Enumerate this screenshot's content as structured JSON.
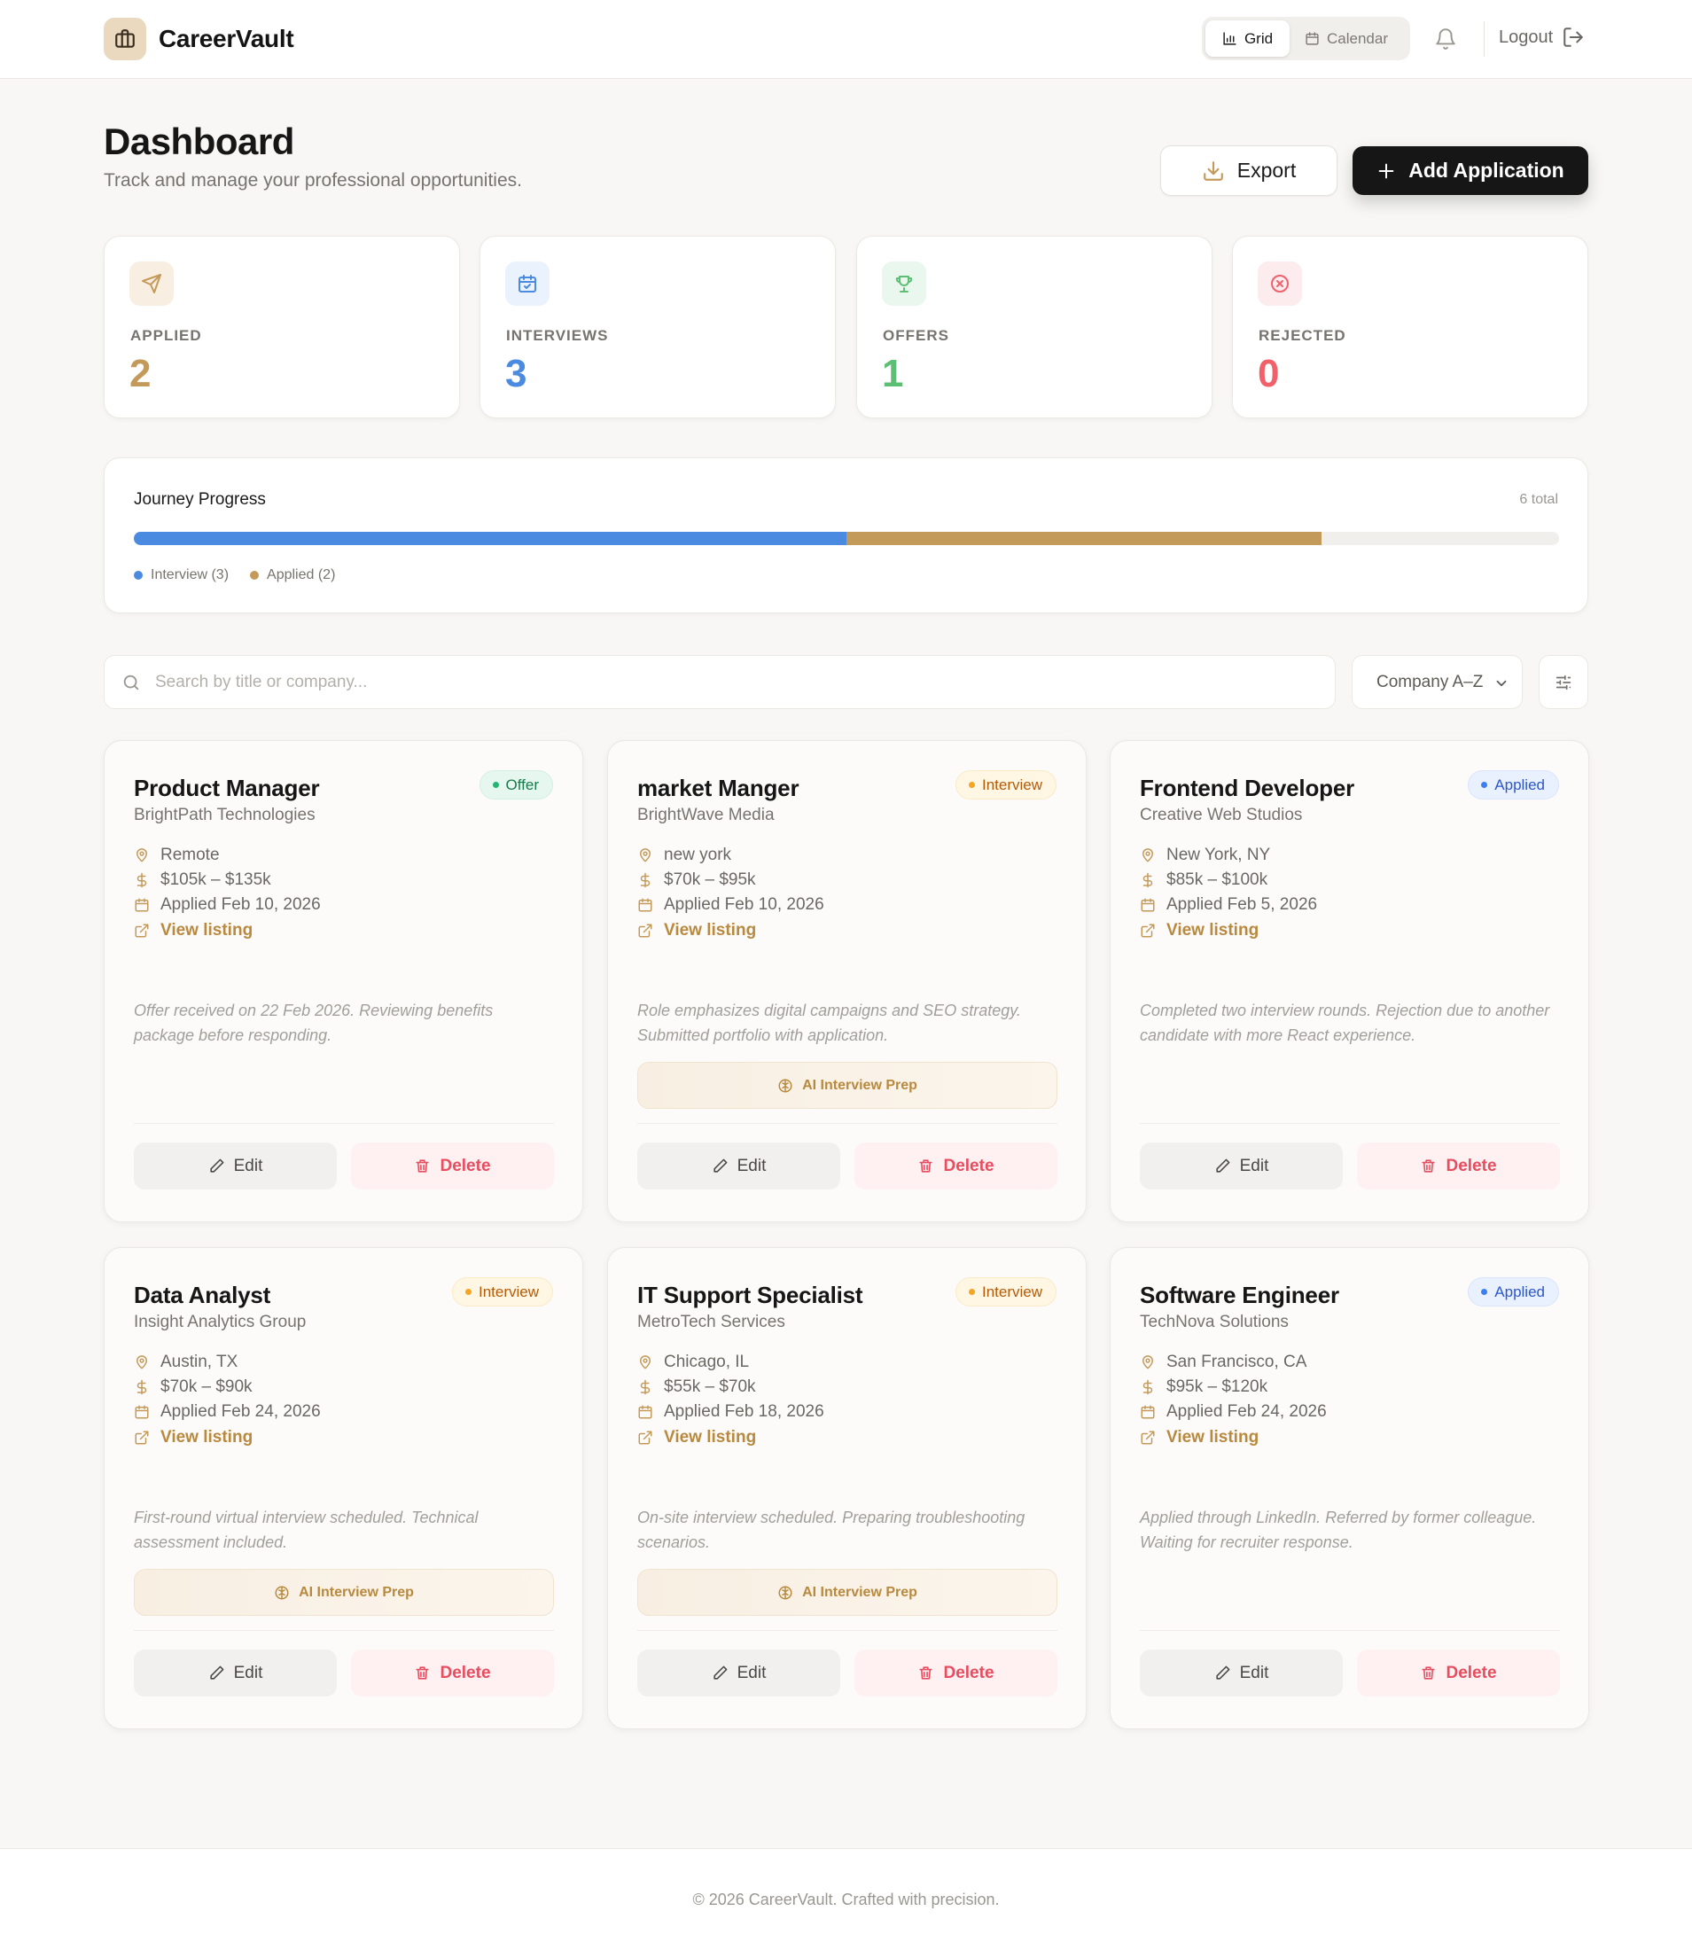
{
  "app": {
    "name": "CareerVault"
  },
  "header": {
    "views": [
      {
        "label": "Grid",
        "active": true
      },
      {
        "label": "Calendar",
        "active": false
      }
    ],
    "logout_label": "Logout"
  },
  "page": {
    "title": "Dashboard",
    "subtitle": "Track and manage your professional opportunities.",
    "export_label": "Export",
    "add_label": "Add Application"
  },
  "stats": [
    {
      "label": "APPLIED",
      "value": "2",
      "color": "#c49a5a",
      "bg": "#f8efe2",
      "icon": "send-icon"
    },
    {
      "label": "INTERVIEWS",
      "value": "3",
      "color": "#4a8ae0",
      "bg": "#eaf2fd",
      "icon": "calendar-check-icon"
    },
    {
      "label": "OFFERS",
      "value": "1",
      "color": "#5cbf73",
      "bg": "#eaf7ee",
      "icon": "trophy-icon"
    },
    {
      "label": "REJECTED",
      "value": "0",
      "color": "#f2606a",
      "bg": "#fdecee",
      "icon": "x-circle-icon"
    }
  ],
  "journey": {
    "title": "Journey Progress",
    "total_label": "6 total",
    "total": 6,
    "segments": [
      {
        "label": "Interview (3)",
        "count": 3,
        "color": "#4a8ae0"
      },
      {
        "label": "Applied (2)",
        "count": 2,
        "color": "#c49a5a"
      }
    ]
  },
  "search": {
    "placeholder": "Search by title or company..."
  },
  "sort": {
    "selected": "Company A–Z"
  },
  "jobs": [
    {
      "title": "Product Manager",
      "company": "BrightPath Technologies",
      "status": "Offer",
      "status_key": "offer",
      "location": "Remote",
      "salary": "$105k – $135k",
      "applied": "Applied Feb 10, 2026",
      "link_label": "View listing",
      "note": "Offer received on 22 Feb 2026. Reviewing benefits package before responding.",
      "ai_prep": ""
    },
    {
      "title": "market Manger",
      "company": "BrightWave Media",
      "status": "Interview",
      "status_key": "interview",
      "location": "new york",
      "salary": "$70k – $95k",
      "applied": "Applied Feb 10, 2026",
      "link_label": "View listing",
      "note": "Role emphasizes digital campaigns and SEO strategy. Submitted portfolio with application.",
      "ai_prep": "AI Interview Prep"
    },
    {
      "title": "Frontend Developer",
      "company": "Creative Web Studios",
      "status": "Applied",
      "status_key": "applied",
      "location": "New York, NY",
      "salary": "$85k – $100k",
      "applied": "Applied Feb 5, 2026",
      "link_label": "View listing",
      "note": "Completed two interview rounds. Rejection due to another candidate with more React experience.",
      "ai_prep": ""
    },
    {
      "title": "Data Analyst",
      "company": "Insight Analytics Group",
      "status": "Interview",
      "status_key": "interview",
      "location": "Austin, TX",
      "salary": "$70k – $90k",
      "applied": "Applied Feb 24, 2026",
      "link_label": "View listing",
      "note": "First-round virtual interview scheduled. Technical assessment included.",
      "ai_prep": "AI Interview Prep"
    },
    {
      "title": "IT Support Specialist",
      "company": "MetroTech Services",
      "status": "Interview",
      "status_key": "interview",
      "location": "Chicago, IL",
      "salary": "$55k – $70k",
      "applied": "Applied Feb 18, 2026",
      "link_label": "View listing",
      "note": "On-site interview scheduled. Preparing troubleshooting scenarios.",
      "ai_prep": "AI Interview Prep"
    },
    {
      "title": "Software Engineer",
      "company": "TechNova Solutions",
      "status": "Applied",
      "status_key": "applied",
      "location": "San Francisco, CA",
      "salary": "$95k – $120k",
      "applied": "Applied Feb 24, 2026",
      "link_label": "View listing",
      "note": "Applied through LinkedIn. Referred by former colleague. Waiting for recruiter response.",
      "ai_prep": ""
    }
  ],
  "card_actions": {
    "edit_label": "Edit",
    "delete_label": "Delete"
  },
  "footer": {
    "text": "© 2026 CareerVault. Crafted with precision."
  }
}
